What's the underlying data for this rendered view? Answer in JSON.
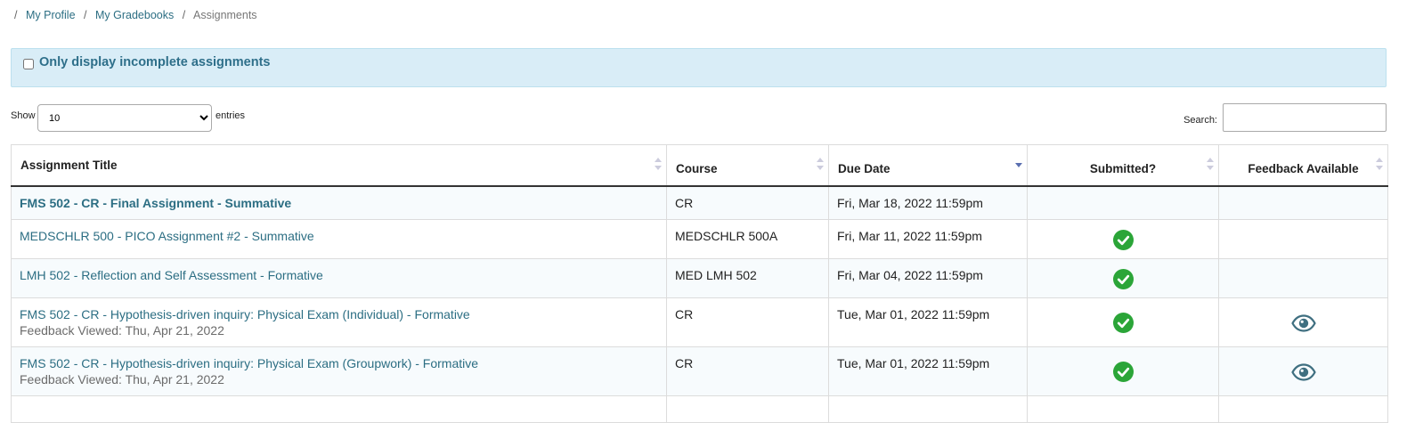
{
  "breadcrumb": {
    "items": [
      {
        "label": "My Profile",
        "link": true
      },
      {
        "label": "My Gradebooks",
        "link": true
      },
      {
        "label": "Assignments",
        "link": false
      }
    ],
    "separator": "/"
  },
  "filter": {
    "label": "Only display incomplete assignments",
    "checked": false
  },
  "length": {
    "show_label": "Show",
    "entries_label": "entries",
    "selected": "10",
    "options": [
      "10"
    ]
  },
  "search": {
    "label": "Search:",
    "value": ""
  },
  "table": {
    "columns": [
      "Assignment Title",
      "Course",
      "Due Date",
      "Submitted?",
      "Feedback Available"
    ],
    "sorted_column": "Due Date",
    "sort_direction": "descending",
    "rows": [
      {
        "title": "FMS 502 - CR - Final Assignment - Summative",
        "bold": true,
        "note": "",
        "course": "CR",
        "due": "Fri, Mar 18, 2022 11:59pm",
        "submitted": false,
        "feedback": false
      },
      {
        "title": "MEDSCHLR 500 - PICO Assignment #2 - Summative",
        "bold": false,
        "note": "",
        "course": "MEDSCHLR 500A",
        "due": "Fri, Mar 11, 2022 11:59pm",
        "submitted": true,
        "feedback": false
      },
      {
        "title": "LMH 502 - Reflection and Self Assessment - Formative",
        "bold": false,
        "note": "",
        "course": "MED LMH 502",
        "due": "Fri, Mar 04, 2022 11:59pm",
        "submitted": true,
        "feedback": false
      },
      {
        "title": "FMS 502 - CR - Hypothesis-driven inquiry: Physical Exam (Individual) - Formative",
        "bold": false,
        "note": "Feedback Viewed: Thu, Apr 21, 2022",
        "course": "CR",
        "due": "Tue, Mar 01, 2022 11:59pm",
        "submitted": true,
        "feedback": true
      },
      {
        "title": "FMS 502 - CR - Hypothesis-driven inquiry: Physical Exam (Groupwork) - Formative",
        "bold": false,
        "note": "Feedback Viewed: Thu, Apr 21, 2022",
        "course": "CR",
        "due": "Tue, Mar 01, 2022 11:59pm",
        "submitted": true,
        "feedback": true
      }
    ]
  },
  "icons": {
    "submitted": "check-circle-icon",
    "feedback": "eye-icon"
  },
  "colors": {
    "link": "#2c6e83",
    "check": "#2ba538",
    "eye": "#3f6f80",
    "filter_bg": "#d9edf7"
  }
}
